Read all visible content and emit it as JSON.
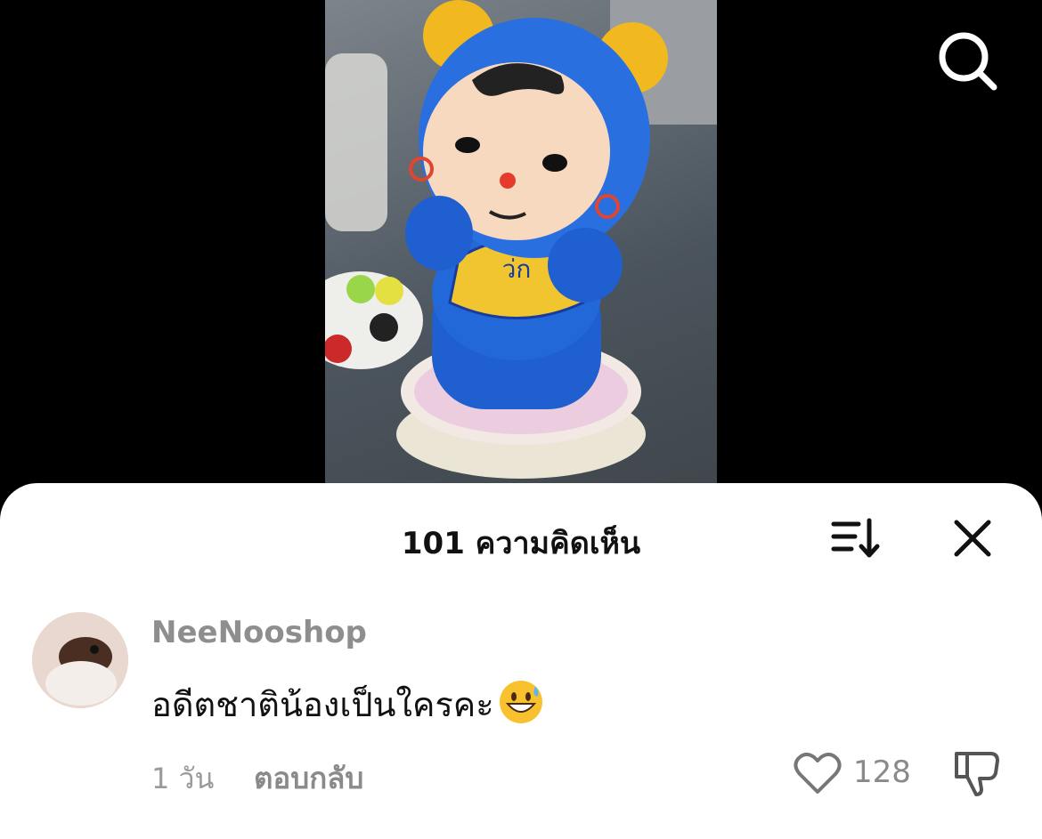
{
  "video": {
    "figure_text": "ว่ก"
  },
  "comments_sheet": {
    "title": "101 ความคิดเห็น",
    "icons": {
      "search": "search-icon",
      "sort": "sort-icon",
      "close": "close-icon"
    }
  },
  "comment": {
    "username": "NeeNooshop",
    "text": "อดีตชาติน้องเป็นใครคะ",
    "emoji": "grinning-sweat-emoji",
    "time": "1 วัน",
    "reply_label": "ตอบกลับ",
    "like_count": "128",
    "icons": {
      "like": "heart-icon",
      "dislike": "thumbs-down-icon"
    }
  },
  "colors": {
    "sheet_bg": "#ffffff",
    "muted_text": "#8e8e8e",
    "primary_text": "#111111"
  }
}
